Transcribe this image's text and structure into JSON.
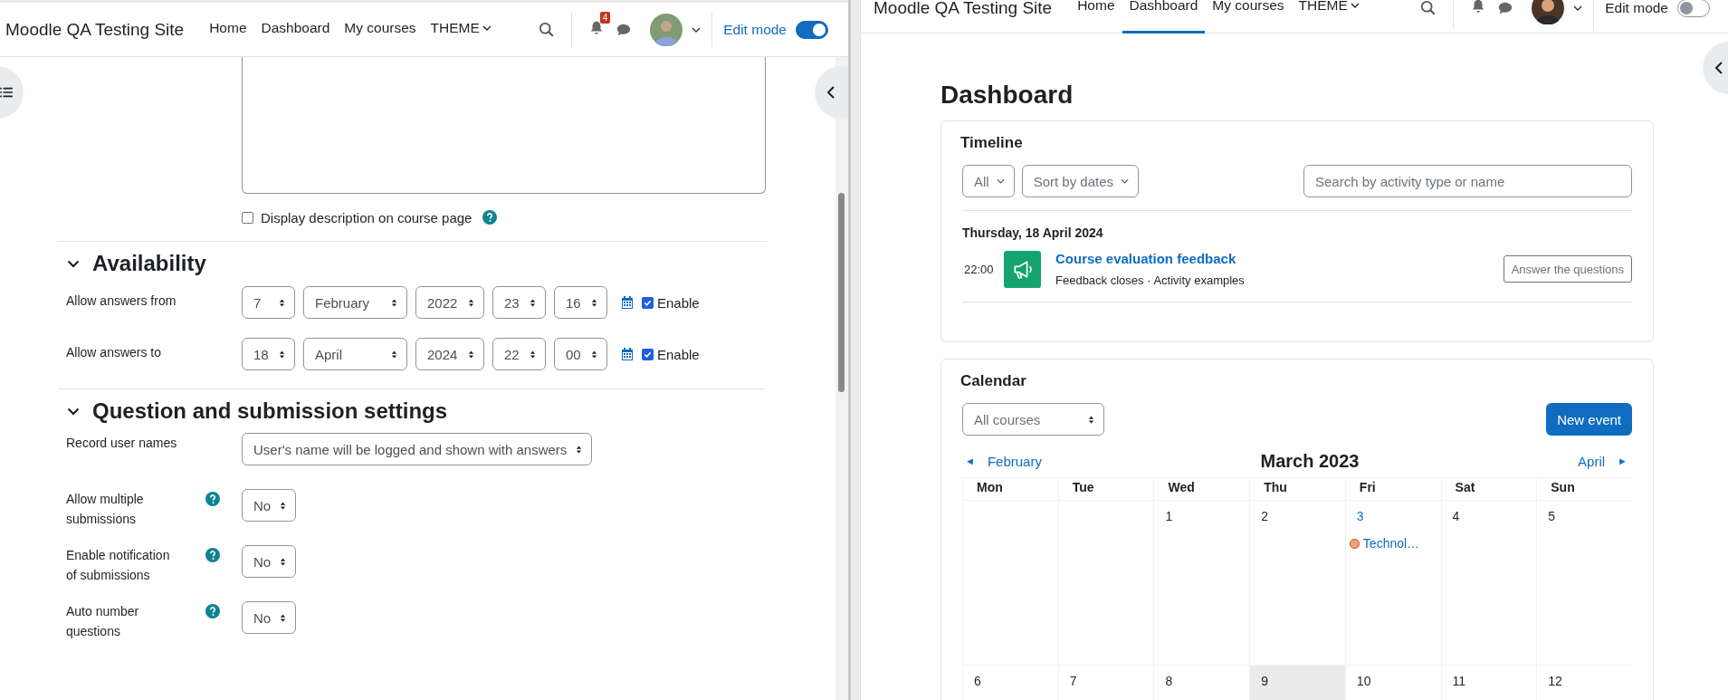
{
  "left_window": {
    "site_name": "Moodle QA Testing Site",
    "nav": [
      {
        "label": "Home",
        "selected": false,
        "has_menu": false
      },
      {
        "label": "Dashboard",
        "selected": false,
        "has_menu": false
      },
      {
        "label": "My courses",
        "selected": false,
        "has_menu": false
      },
      {
        "label": "THEME",
        "selected": false,
        "has_menu": true
      }
    ],
    "notification_count": "4",
    "edit_mode": {
      "label": "Edit mode",
      "on": true
    },
    "description_option": {
      "label": "Display description on course page",
      "checked": false,
      "help": true
    },
    "sections": [
      {
        "title": "Availability",
        "expanded": true,
        "fields": [
          {
            "kind": "datetime",
            "label": "Allow answers from",
            "selects": [
              "7",
              "February",
              "2022",
              "23",
              "16"
            ],
            "enable": {
              "label": "Enable",
              "checked": true
            }
          },
          {
            "kind": "datetime",
            "label": "Allow answers to",
            "selects": [
              "18",
              "April",
              "2024",
              "22",
              "00"
            ],
            "enable": {
              "label": "Enable",
              "checked": true
            }
          }
        ]
      },
      {
        "title": "Question and submission settings",
        "expanded": true,
        "fields": [
          {
            "kind": "select",
            "label": "Record user names",
            "help": false,
            "value": "User's name will be logged and shown with answers"
          },
          {
            "kind": "select",
            "label": "Allow multiple submissions",
            "help": true,
            "value": "No"
          },
          {
            "kind": "select",
            "label": "Enable notification of submissions",
            "help": true,
            "value": "No"
          },
          {
            "kind": "select",
            "label": "Auto number questions",
            "help": true,
            "value": "No"
          }
        ]
      }
    ]
  },
  "right_window": {
    "site_name": "Moodle QA Testing Site",
    "nav": [
      {
        "label": "Home",
        "selected": false,
        "has_menu": false
      },
      {
        "label": "Dashboard",
        "selected": true,
        "has_menu": false
      },
      {
        "label": "My courses",
        "selected": false,
        "has_menu": false
      },
      {
        "label": "THEME",
        "selected": false,
        "has_menu": true
      }
    ],
    "edit_mode": {
      "label": "Edit mode",
      "on": false
    },
    "page_title": "Dashboard",
    "timeline": {
      "title": "Timeline",
      "filter": "All",
      "sort": "Sort by dates",
      "search": {
        "placeholder": "Search by activity type or name"
      },
      "date": "Thursday, 18 April 2024",
      "events": [
        {
          "time": "22:00",
          "name": "Course evaluation feedback",
          "details": "Feedback closes · Activity examples",
          "action": "Answer the questions"
        }
      ]
    },
    "calendar": {
      "title": "Calendar",
      "course_filter": "All courses",
      "new_event": "New event",
      "previous": "◄",
      "previous_month": "February",
      "month": "March 2023",
      "next_month": "April",
      "next": "►",
      "weekdays": [
        "Mon",
        "Tue",
        "Wed",
        "Thu",
        "Fri",
        "Sat",
        "Sun"
      ],
      "weeks": [
        [
          {
            "kind": "blank"
          },
          {
            "kind": "blank"
          },
          {
            "kind": "day",
            "day": "1",
            "today": false
          },
          {
            "kind": "day",
            "day": "2",
            "today": false
          },
          {
            "kind": "day",
            "day": "3",
            "today": false,
            "events": [
              {
                "label": "Technol…",
                "color": "#f0a47a"
              }
            ]
          },
          {
            "kind": "day",
            "day": "4",
            "today": false
          },
          {
            "kind": "day",
            "day": "5",
            "today": false
          }
        ],
        [
          {
            "kind": "day",
            "day": "6",
            "today": false
          },
          {
            "kind": "day",
            "day": "7",
            "today": false
          },
          {
            "kind": "day",
            "day": "8",
            "today": false
          },
          {
            "kind": "day",
            "day": "9",
            "today": true
          },
          {
            "kind": "day",
            "day": "10",
            "today": false
          },
          {
            "kind": "day",
            "day": "11",
            "today": false
          },
          {
            "kind": "day",
            "day": "12",
            "today": false
          }
        ]
      ]
    }
  }
}
